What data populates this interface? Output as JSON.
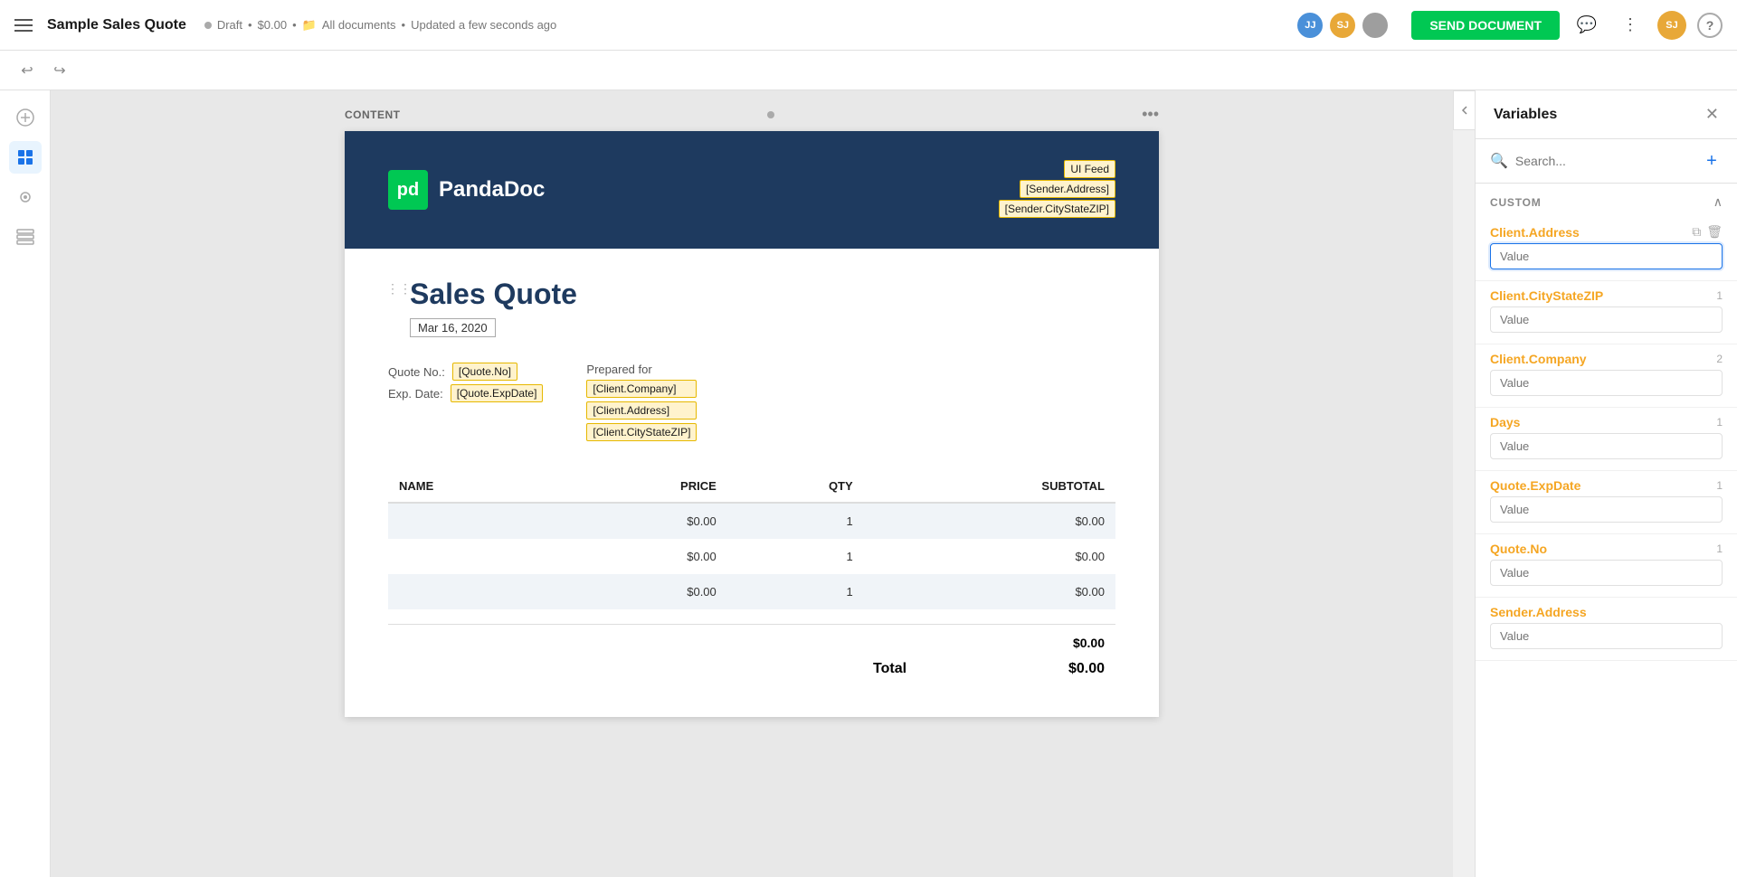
{
  "topbar": {
    "title": "Sample Sales Quote",
    "status": "Draft",
    "amount": "$0.00",
    "location": "All documents",
    "updated": "Updated a few seconds ago",
    "send_button": "SEND DOCUMENT",
    "avatars": [
      {
        "initials": "JJ",
        "color": "#4a90d9"
      },
      {
        "initials": "SJ",
        "color": "#e8a838"
      },
      {
        "initials": "",
        "color": "#888"
      }
    ],
    "user_initials": "SJ",
    "help": "?"
  },
  "toolbar": {
    "undo": "↩",
    "redo": "↪"
  },
  "document": {
    "content_label": "CONTENT",
    "header": {
      "logo_text": "pd",
      "company_name": "PandaDoc",
      "ui_feed_tag": "UI Feed",
      "sender_address_tag": "[Sender.Address]",
      "sender_citystate_tag": "[Sender.CityStateZIP]"
    },
    "body": {
      "title": "Sales Quote",
      "date": "Mar 16, 2020",
      "quote_no_label": "Quote No.:",
      "quote_no_value": "[Quote.No]",
      "exp_date_label": "Exp. Date:",
      "exp_date_value": "[Quote.ExpDate]",
      "prepared_for_label": "Prepared for",
      "client_company_tag": "[Client.Company]",
      "client_address_tag": "[Client.Address]",
      "client_citystate_tag": "[Client.CityStateZIP]",
      "table": {
        "columns": [
          "NAME",
          "PRICE",
          "QTY",
          "SUBTOTAL"
        ],
        "rows": [
          {
            "name": "",
            "price": "$0.00",
            "qty": "1",
            "subtotal": "$0.00"
          },
          {
            "name": "",
            "price": "$0.00",
            "qty": "1",
            "subtotal": "$0.00"
          },
          {
            "name": "",
            "price": "$0.00",
            "qty": "1",
            "subtotal": "$0.00"
          }
        ]
      },
      "subtotal_label": "",
      "subtotal_value": "$0.00",
      "total_label": "Total",
      "total_value": "$0.00"
    }
  },
  "variables_panel": {
    "title": "Variables",
    "search_placeholder": "Search...",
    "add_button": "+",
    "close_button": "✕",
    "custom_section_label": "CUSTOM",
    "variables": [
      {
        "name": "Client.Address",
        "count": null,
        "placeholder": "Value",
        "active": true
      },
      {
        "name": "Client.CityStateZIP",
        "count": "1",
        "placeholder": "Value",
        "active": false
      },
      {
        "name": "Client.Company",
        "count": "2",
        "placeholder": "Value",
        "active": false
      },
      {
        "name": "Days",
        "count": "1",
        "placeholder": "Value",
        "active": false
      },
      {
        "name": "Quote.ExpDate",
        "count": "1",
        "placeholder": "Value",
        "active": false
      },
      {
        "name": "Quote.No",
        "count": "1",
        "placeholder": "Value",
        "active": false
      },
      {
        "name": "Sender.Address",
        "count": null,
        "placeholder": "Value",
        "active": false
      }
    ]
  },
  "left_sidebar": {
    "icons": [
      "≡",
      "⊞",
      "🎨",
      "⊡"
    ]
  },
  "colors": {
    "brand_blue": "#1e3a5f",
    "brand_green": "#00c853",
    "highlight_yellow": "#fff3cd",
    "variable_orange": "#f5a623",
    "send_green": "#00c853",
    "active_blue": "#1a73e8"
  }
}
